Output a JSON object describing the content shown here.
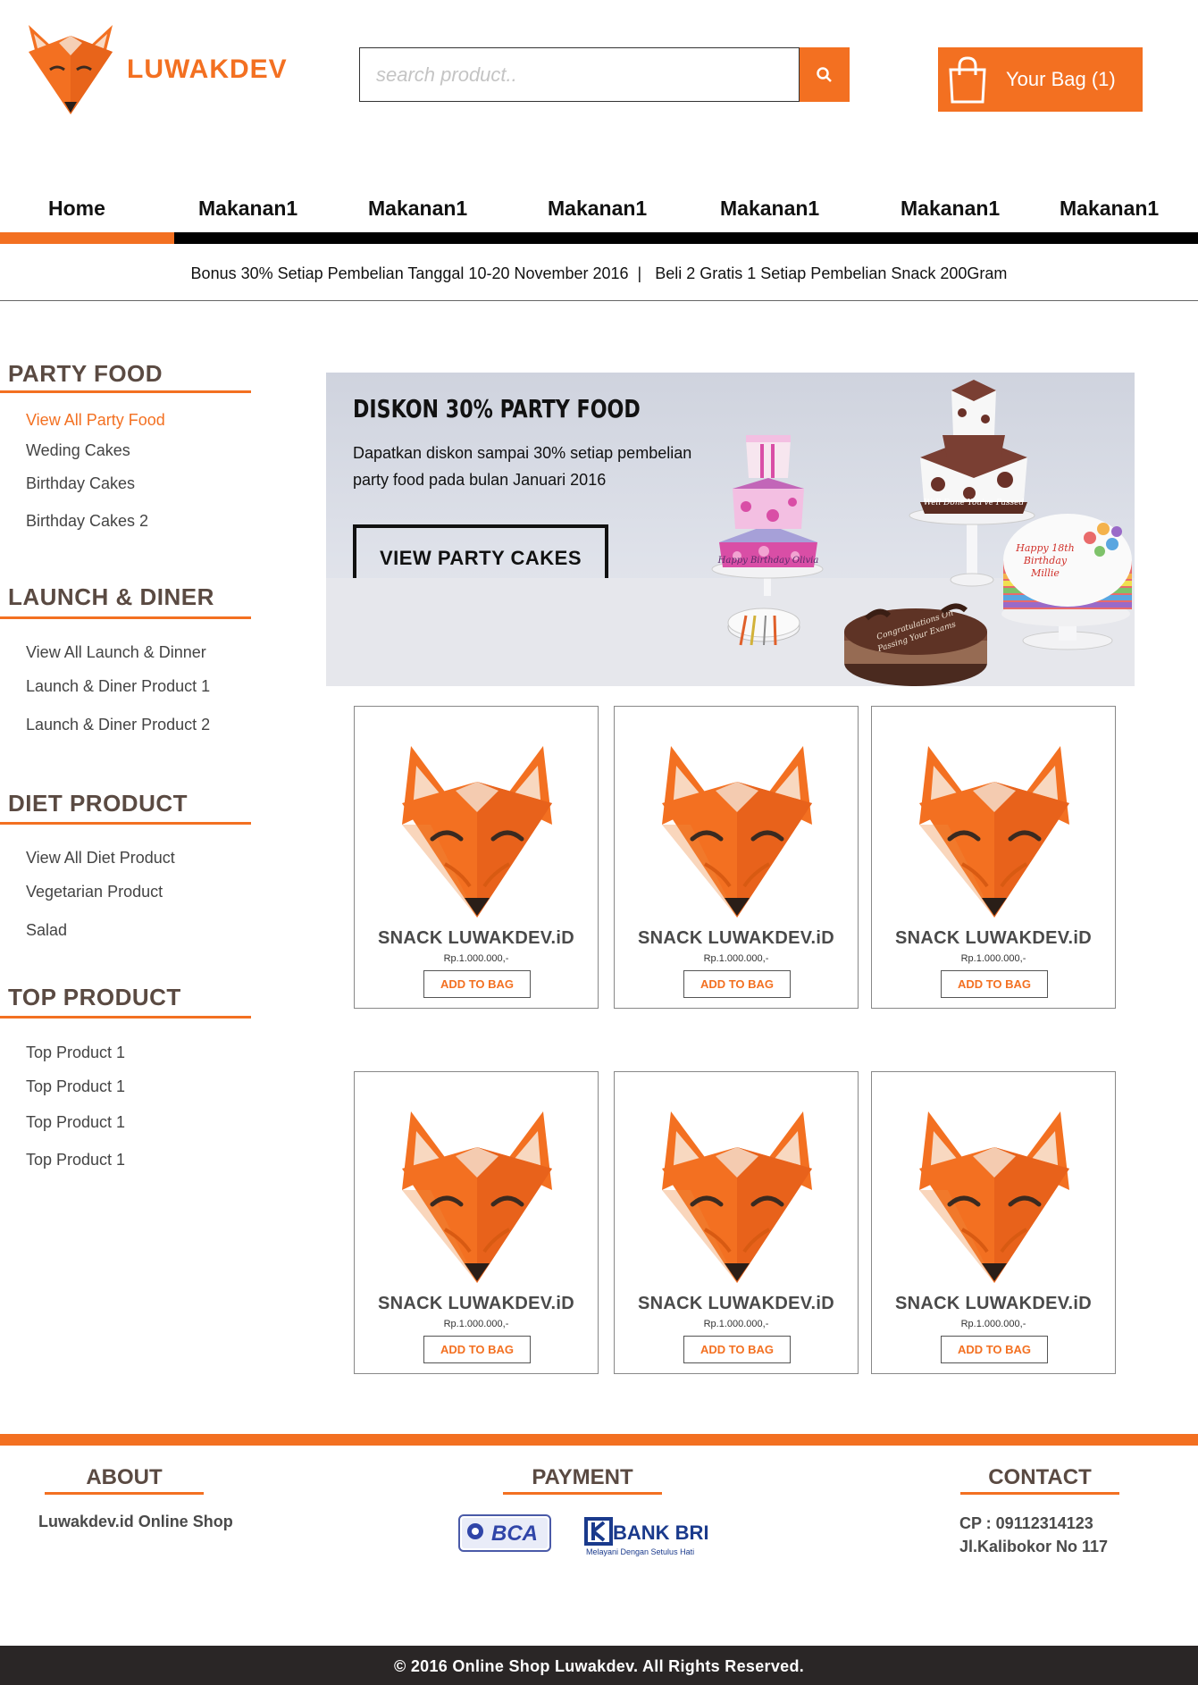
{
  "brand": {
    "name": "LUWAKDEV",
    "color": "#f37021"
  },
  "search": {
    "placeholder": "search product..",
    "icon": "search-icon"
  },
  "bag": {
    "label": "Your Bag (1)",
    "icon": "shopping-bag-icon"
  },
  "nav": {
    "items": [
      "Home",
      "Makanan1",
      "Makanan1",
      "Makanan1",
      "Makanan1",
      "Makanan1",
      "Makanan1"
    ],
    "active": "Home"
  },
  "promo": {
    "text": "Bonus 30% Setiap Pembelian Tanggal 10-20 November 2016  |   Beli 2 Gratis 1 Setiap Pembelian Snack 200Gram"
  },
  "sidebar": [
    {
      "title": "PARTY FOOD",
      "links": [
        "View All Party Food",
        "Weding Cakes",
        "Birthday Cakes",
        "Birthday Cakes 2"
      ],
      "active": "View All Party Food"
    },
    {
      "title": "LAUNCH & DINER",
      "links": [
        "View All Launch & Dinner",
        "Launch & Diner Product 1",
        "Launch & Diner Product 2"
      ]
    },
    {
      "title": "DIET PRODUCT",
      "links": [
        "View All Diet Product",
        "Vegetarian Product",
        "Salad"
      ]
    },
    {
      "title": "TOP PRODUCT",
      "links": [
        "Top Product 1",
        "Top Product 1",
        "Top Product 1",
        "Top Product 1"
      ]
    }
  ],
  "banner": {
    "title": "DISKON 30% PARTY FOOD",
    "desc_line1": "Dapatkan diskon sampai 30% setiap pembelian",
    "desc_line2": "party food pada bulan Januari 2016",
    "button": "VIEW PARTY CAKES",
    "cake1_text": "Happy Birthday Olivia",
    "cake2_text": "Well Done You've Passed",
    "cake3_line1": "Happy 18th",
    "cake3_line2": "Birthday",
    "cake3_line3": "Millie",
    "cake4_line1": "Congratulations On",
    "cake4_line2": "Passing Your Exams"
  },
  "products": [
    {
      "name": "SNACK LUWAKDEV.iD",
      "price": "Rp.1.000.000,-",
      "button": "ADD TO BAG"
    },
    {
      "name": "SNACK LUWAKDEV.iD",
      "price": "Rp.1.000.000,-",
      "button": "ADD TO BAG"
    },
    {
      "name": "SNACK LUWAKDEV.iD",
      "price": "Rp.1.000.000,-",
      "button": "ADD TO BAG"
    },
    {
      "name": "SNACK LUWAKDEV.iD",
      "price": "Rp.1.000.000,-",
      "button": "ADD TO BAG"
    },
    {
      "name": "SNACK LUWAKDEV.iD",
      "price": "Rp.1.000.000,-",
      "button": "ADD TO BAG"
    },
    {
      "name": "SNACK LUWAKDEV.iD",
      "price": "Rp.1.000.000,-",
      "button": "ADD TO BAG"
    }
  ],
  "footer": {
    "about": {
      "title": "ABOUT",
      "text": "Luwakdev.id Online Shop"
    },
    "payment": {
      "title": "PAYMENT",
      "bca": "BCA",
      "bri": "BANK BRI",
      "bri_tagline": "Melayani Dengan Setulus Hati"
    },
    "contact": {
      "title": "CONTACT",
      "phone": "CP : 09112314123",
      "address": "Jl.Kalibokor No 117"
    },
    "copyright": "© 2016 Online Shop Luwakdev. All Rights Reserved."
  }
}
